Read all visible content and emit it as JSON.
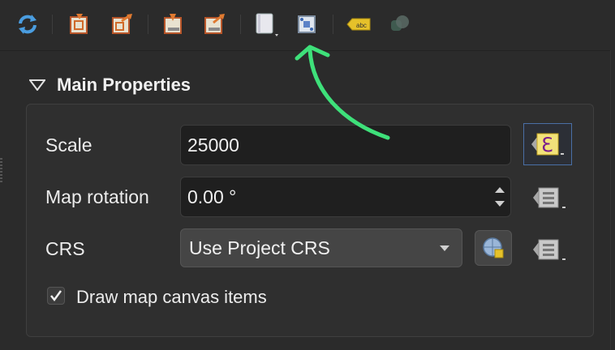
{
  "toolbar": {
    "buttons": [
      {
        "icon": "refresh-icon"
      },
      {
        "icon": "set-extent-from-canvas-icon"
      },
      {
        "icon": "view-extent-in-canvas-icon"
      },
      {
        "icon": "set-scale-from-canvas-icon"
      },
      {
        "icon": "set-canvas-scale-icon"
      },
      {
        "icon": "bookmark-icon"
      },
      {
        "icon": "interactive-extent-icon"
      },
      {
        "icon": "label-settings-icon"
      },
      {
        "icon": "clipping-icon"
      }
    ]
  },
  "section": {
    "title": "Main Properties"
  },
  "scale": {
    "label": "Scale",
    "value": "25000"
  },
  "rotation": {
    "label": "Map rotation",
    "value": "0.00 °"
  },
  "crs": {
    "label": "CRS",
    "value": "Use Project CRS"
  },
  "draw_items": {
    "label": "Draw map canvas items",
    "checked": true
  },
  "colors": {
    "annotation_arrow": "#3ee07a",
    "accent": "#4a6fa5"
  }
}
